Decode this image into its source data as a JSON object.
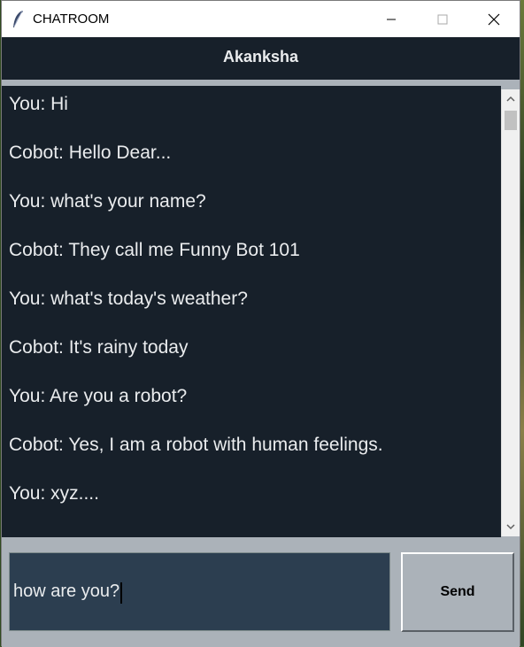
{
  "window": {
    "title": "CHATROOM"
  },
  "header": {
    "name": "Akanksha"
  },
  "chat": {
    "messages": [
      "You: Hi",
      "Cobot: Hello Dear...",
      "You: what's your name?",
      "Cobot: They call me Funny Bot 101",
      "You: what's today's weather?",
      "Cobot: It's rainy today",
      "You: Are you a robot?",
      "Cobot: Yes, I am a robot with human feelings.",
      "You: xyz...."
    ]
  },
  "composer": {
    "value": "how are you?",
    "send_label": "Send"
  },
  "icons": {
    "app": "feather-icon",
    "minimize": "minimize-icon",
    "maximize": "maximize-icon",
    "close": "close-icon",
    "scroll_up": "chevron-up-icon",
    "scroll_down": "chevron-down-icon"
  },
  "colors": {
    "chat_bg": "#17202a",
    "text": "#eaecee",
    "panel": "#abb2b9",
    "input_bg": "#2c3e50"
  }
}
